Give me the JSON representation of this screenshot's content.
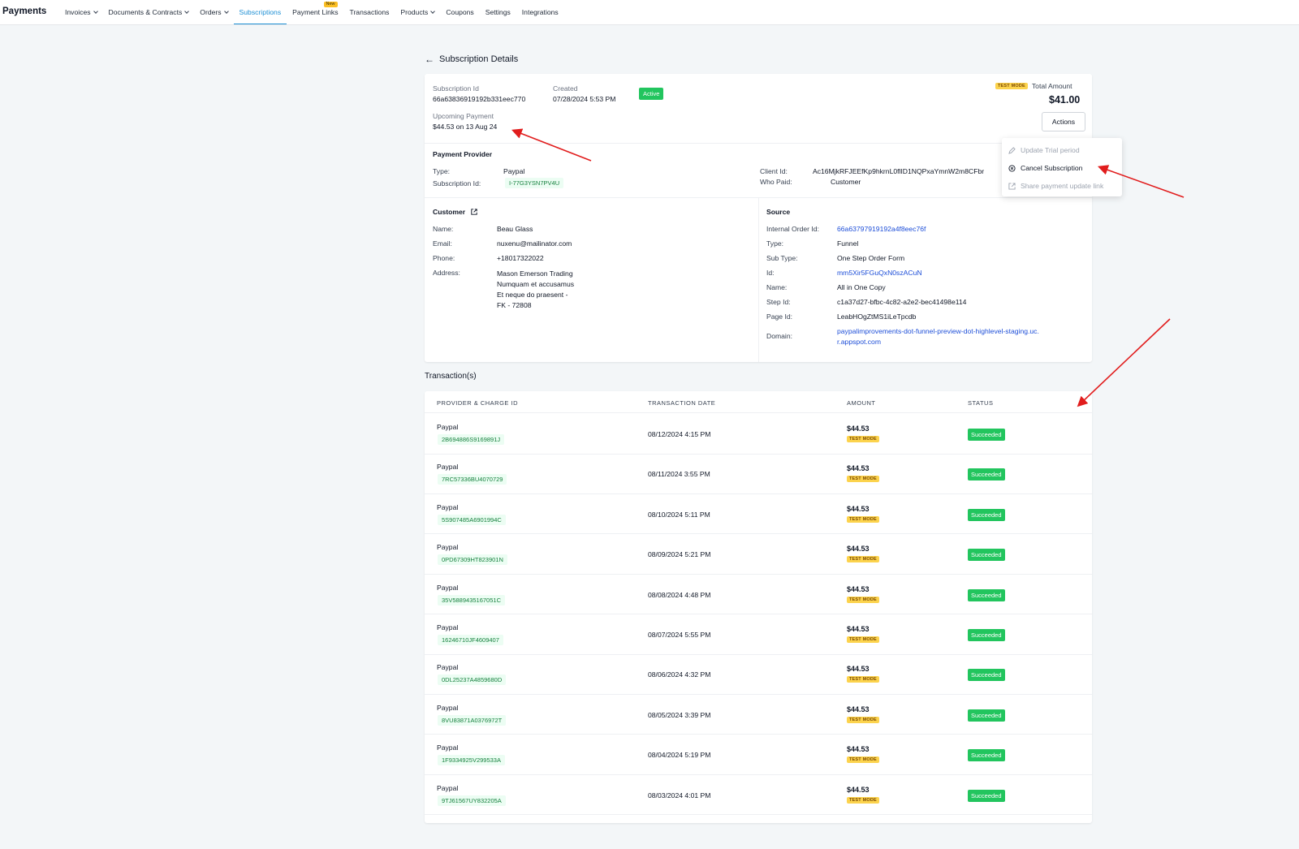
{
  "app": {
    "title": "Payments"
  },
  "nav": [
    {
      "label": "Invoices",
      "dropdown": true
    },
    {
      "label": "Documents & Contracts",
      "dropdown": true
    },
    {
      "label": "Orders",
      "dropdown": true
    },
    {
      "label": "Subscriptions",
      "active": true
    },
    {
      "label": "Payment Links",
      "badge": "New"
    },
    {
      "label": "Transactions"
    },
    {
      "label": "Products",
      "dropdown": true
    },
    {
      "label": "Coupons"
    },
    {
      "label": "Settings"
    },
    {
      "label": "Integrations"
    }
  ],
  "header": {
    "title": "Subscription Details"
  },
  "subscription": {
    "id_label": "Subscription Id",
    "id_value": "66a63836919192b331eec770",
    "created_label": "Created",
    "created_value": "07/28/2024 5:53 PM",
    "status": "Active",
    "upcoming_label": "Upcoming Payment",
    "upcoming_value": "$44.53 on 13 Aug 24",
    "test_mode": "TEST MODE",
    "total_label": "Total Amount",
    "total_value": "$41.00",
    "actions_label": "Actions"
  },
  "actions_menu": [
    {
      "label": "Update Trial period",
      "enabled": false,
      "icon": "pencil-icon"
    },
    {
      "label": "Cancel Subscription",
      "enabled": true,
      "icon": "circle-x-icon"
    },
    {
      "label": "Share payment update link",
      "enabled": false,
      "icon": "external-link-icon"
    }
  ],
  "payment_provider": {
    "title": "Payment Provider",
    "type_label": "Type:",
    "type_value": "Paypal",
    "sub_id_label": "Subscription Id:",
    "sub_id_value": "I-77G3YSN7PV4U",
    "client_id_label": "Client Id:",
    "client_id_value": "Ac16MjkRFJEEfKp9hkrnL0flID1NQPxaYmnW2m8CFbr",
    "who_paid_label": "Who Paid:",
    "who_paid_value": "Customer"
  },
  "customer": {
    "title": "Customer",
    "name_label": "Name:",
    "name_value": "Beau Glass",
    "email_label": "Email:",
    "email_value": "nuxenu@mailinator.com",
    "phone_label": "Phone:",
    "phone_value": "+18017322022",
    "address_label": "Address:",
    "address_lines": [
      "Mason Emerson Trading",
      "Numquam et accusamus",
      "Et neque do praesent -",
      "FK - 72808"
    ]
  },
  "source": {
    "title": "Source",
    "internal_order_label": "Internal Order Id:",
    "internal_order_value": "66a63797919192a4f8eec76f",
    "type_label": "Type:",
    "type_value": "Funnel",
    "sub_type_label": "Sub Type:",
    "sub_type_value": "One Step Order Form",
    "id_label": "Id:",
    "id_value": "mm5Xir5FGuQxN0szACuN",
    "name_label": "Name:",
    "name_value": "All in One Copy",
    "step_id_label": "Step Id:",
    "step_id_value": "c1a37d27-bfbc-4c82-a2e2-bec41498e114",
    "page_id_label": "Page Id:",
    "page_id_value": "LeabHOgZtMS1iLeTpcdb",
    "domain_label": "Domain:",
    "domain_line1": "paypalimprovements-dot-funnel-preview-dot-highlevel-staging.uc.",
    "domain_line2": "r.appspot.com"
  },
  "transactions": {
    "title": "Transaction(s)",
    "columns": [
      "PROVIDER & CHARGE ID",
      "TRANSACTION DATE",
      "AMOUNT",
      "STATUS"
    ],
    "rows": [
      {
        "provider": "Paypal",
        "charge_id": "2B694886S9169891J",
        "date": "08/12/2024 4:15 PM",
        "amount": "$44.53",
        "mode": "TEST MODE",
        "status": "Succeeded"
      },
      {
        "provider": "Paypal",
        "charge_id": "7RC57336BU4070729",
        "date": "08/11/2024 3:55 PM",
        "amount": "$44.53",
        "mode": "TEST MODE",
        "status": "Succeeded"
      },
      {
        "provider": "Paypal",
        "charge_id": "5S907485A6901994C",
        "date": "08/10/2024 5:11 PM",
        "amount": "$44.53",
        "mode": "TEST MODE",
        "status": "Succeeded"
      },
      {
        "provider": "Paypal",
        "charge_id": "0PD67309HT823901N",
        "date": "08/09/2024 5:21 PM",
        "amount": "$44.53",
        "mode": "TEST MODE",
        "status": "Succeeded"
      },
      {
        "provider": "Paypal",
        "charge_id": "35V5889435167051C",
        "date": "08/08/2024 4:48 PM",
        "amount": "$44.53",
        "mode": "TEST MODE",
        "status": "Succeeded"
      },
      {
        "provider": "Paypal",
        "charge_id": "16246710JF4609407",
        "date": "08/07/2024 5:55 PM",
        "amount": "$44.53",
        "mode": "TEST MODE",
        "status": "Succeeded"
      },
      {
        "provider": "Paypal",
        "charge_id": "0DL25237A4859680D",
        "date": "08/06/2024 4:32 PM",
        "amount": "$44.53",
        "mode": "TEST MODE",
        "status": "Succeeded"
      },
      {
        "provider": "Paypal",
        "charge_id": "8VU83871A0376972T",
        "date": "08/05/2024 3:39 PM",
        "amount": "$44.53",
        "mode": "TEST MODE",
        "status": "Succeeded"
      },
      {
        "provider": "Paypal",
        "charge_id": "1F9334925V299533A",
        "date": "08/04/2024 5:19 PM",
        "amount": "$44.53",
        "mode": "TEST MODE",
        "status": "Succeeded"
      },
      {
        "provider": "Paypal",
        "charge_id": "9TJ61567UY832205A",
        "date": "08/03/2024 4:01 PM",
        "amount": "$44.53",
        "mode": "TEST MODE",
        "status": "Succeeded"
      }
    ]
  },
  "colors": {
    "accent": "#1d8fd4",
    "success": "#22c55e",
    "test_mode": "#fcd34d",
    "annotation_arrow": "#e11d1d"
  }
}
